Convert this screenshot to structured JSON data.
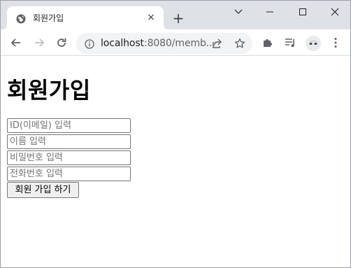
{
  "browser": {
    "tab": {
      "title": "회원가입",
      "favicon": "globe-icon",
      "close": "×"
    },
    "new_tab": "+",
    "window_controls": [
      "tab-search-icon",
      "minimize-icon",
      "maximize-icon",
      "close-icon"
    ],
    "toolbar": {
      "back": "arrow-left-icon",
      "forward": "arrow-right-icon",
      "reload": "reload-icon",
      "extensions": "puzzle-icon",
      "reading_list": "reading-list-icon",
      "menu": "kebab-menu-icon"
    },
    "omnibox": {
      "url_host": "localhost",
      "url_rest": ":8080/memb...",
      "info": "info-icon",
      "share": "share-icon",
      "bookmark": "star-icon"
    }
  },
  "page": {
    "title": "회원가입",
    "fields": {
      "id_placeholder": "ID(이메일) 입력",
      "name_placeholder": "이름 입력",
      "password_placeholder": "비밀번호 입력",
      "phone_placeholder": "전화번호 입력"
    },
    "submit_label": "회원 가입 하기"
  },
  "colors": {
    "tabstrip": "#dee1e6",
    "omnibox": "#f1f3f4",
    "button_bg": "#efefef"
  }
}
